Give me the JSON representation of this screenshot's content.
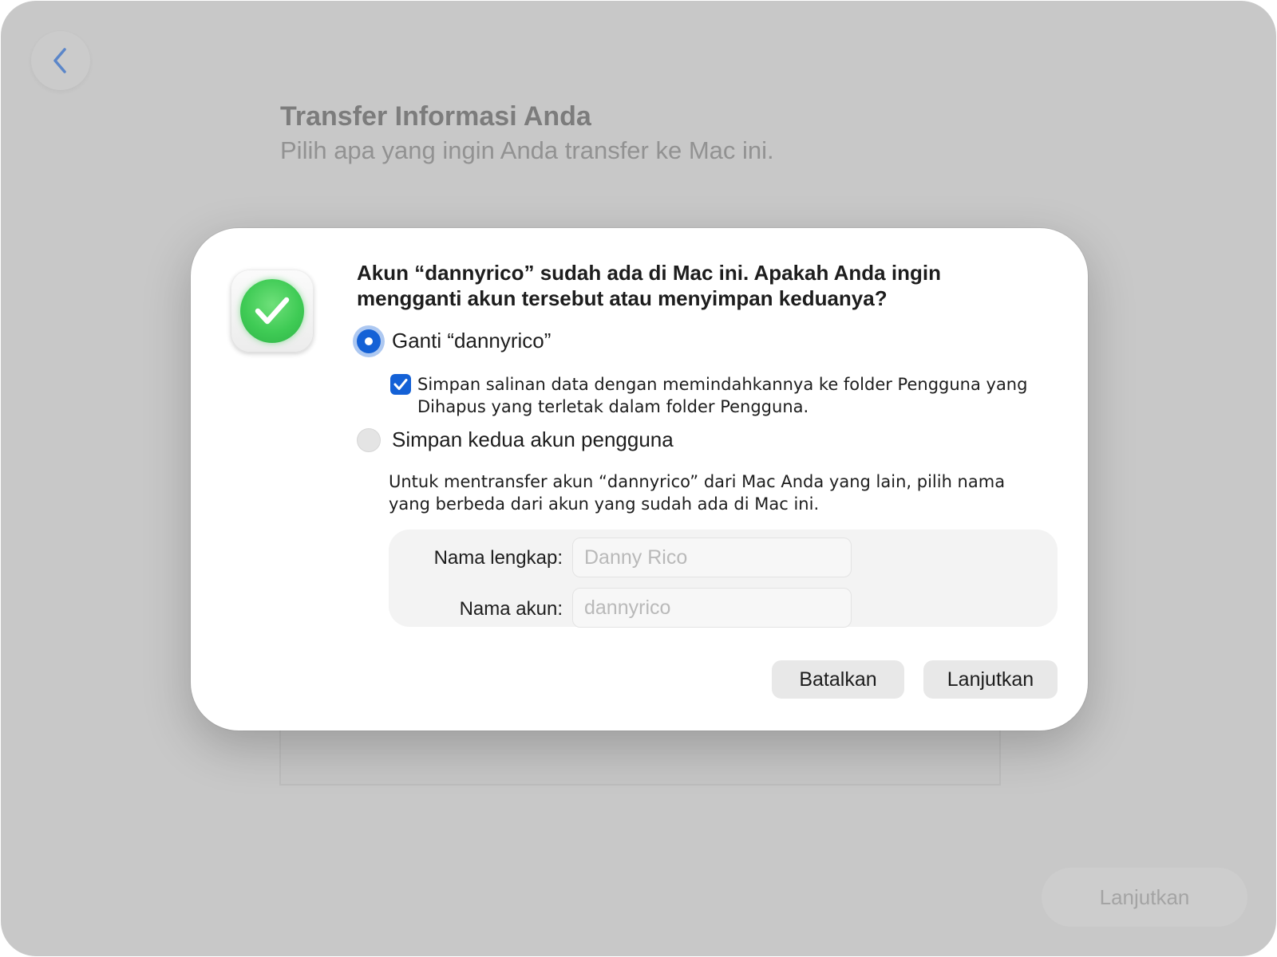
{
  "background": {
    "back_icon": "chevron-left-icon",
    "title": "Transfer Informasi Anda",
    "subtitle": "Pilih apa yang ingin Anda transfer ke Mac ini.",
    "continue_label": "Lanjutkan"
  },
  "dialog": {
    "icon": "checkmark-circle-icon",
    "question": "Akun “dannyrico” sudah ada di Mac ini. Apakah Anda ingin mengganti akun tersebut atau menyimpan keduanya?",
    "option_replace": {
      "label": "Ganti “dannyrico”",
      "selected": true
    },
    "keep_copy": {
      "label": "Simpan salinan data dengan memindahkannya ke folder Pengguna yang Dihapus yang terletak dalam folder Pengguna.",
      "checked": true
    },
    "option_keep_both": {
      "label": "Simpan kedua akun pengguna",
      "selected": false
    },
    "keep_both_description": "Untuk mentransfer akun “dannyrico” dari Mac Anda yang lain, pilih nama yang berbeda dari akun yang sudah ada di Mac ini.",
    "full_name": {
      "label": "Nama lengkap:",
      "placeholder": "Danny Rico",
      "value": ""
    },
    "account_name": {
      "label": "Nama akun:",
      "placeholder": "dannyrico",
      "value": ""
    },
    "cancel_label": "Batalkan",
    "continue_label": "Lanjutkan"
  },
  "colors": {
    "accent": "#1461d6",
    "success": "#3fcb55",
    "window_background": "#c8c8c8"
  }
}
